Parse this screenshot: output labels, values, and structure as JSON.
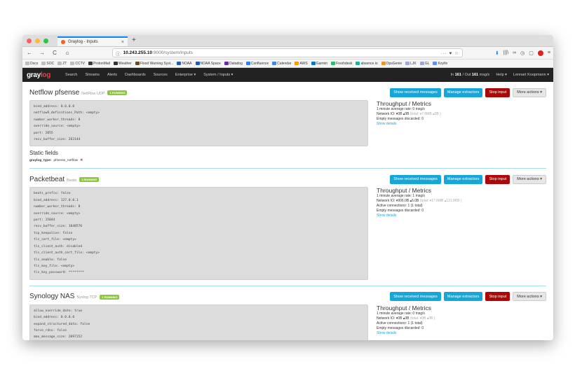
{
  "browser": {
    "tab_title": "Graylog - Inputs",
    "tab_close": "×",
    "new_tab": "+",
    "url_host": "10.243.255.10",
    "url_path": ":9000/system/inputs",
    "url_actions": "··· ♥ ☆",
    "back": "←",
    "forward": "→",
    "reload": "C",
    "home": "⌂",
    "right_icons": [
      "⬇",
      "|||\\",
      "∞",
      "◷",
      "▢",
      "≡"
    ]
  },
  "bookmarks": [
    {
      "label": "Docs",
      "color": "#bdbdbd"
    },
    {
      "label": "SOC",
      "color": "#bdbdbd"
    },
    {
      "label": "ZT",
      "color": "#bdbdbd"
    },
    {
      "label": "CCTV",
      "color": "#bdbdbd"
    },
    {
      "label": "ProtonMail",
      "color": "#3b3b3b"
    },
    {
      "label": "Weather",
      "color": "#333333"
    },
    {
      "label": "Flood Warning Syst...",
      "color": "#6a4d1f"
    },
    {
      "label": "NOAA",
      "color": "#1e5fb4"
    },
    {
      "label": "NOAA Space",
      "color": "#1e5fb4"
    },
    {
      "label": "Datadog",
      "color": "#632ca6"
    },
    {
      "label": "Confluence",
      "color": "#2684ff"
    },
    {
      "label": "Calendar",
      "color": "#4285f4"
    },
    {
      "label": "AWS",
      "color": "#ff9900"
    },
    {
      "label": "Garmin",
      "color": "#007cc3"
    },
    {
      "label": "Freshdesk",
      "color": "#25c16f"
    },
    {
      "label": "absence.io",
      "color": "#1db1a4"
    },
    {
      "label": "OpsGenie",
      "color": "#f29221"
    },
    {
      "label": "LJK",
      "color": "#9fa8da"
    },
    {
      "label": "GL",
      "color": "#9fa8da"
    },
    {
      "label": "Koyfin",
      "color": "#5b8ff9"
    }
  ],
  "graylog_nav": {
    "logo_a": "gray",
    "logo_b": "log",
    "items": [
      "Search",
      "Streams",
      "Alerts",
      "Dashboards",
      "Sources",
      "Enterprise ▾",
      "System / Inputs ▾"
    ],
    "throughput_prefix": "In ",
    "throughput_in": "161",
    "throughput_mid": " / Out ",
    "throughput_out": "161",
    "throughput_suffix": " msg/s",
    "help": "Help ▾",
    "user": "Lennart Koopmann ▾"
  },
  "buttons": {
    "show_received": "Show received messages",
    "manage_extractors": "Manage extractors",
    "stop_input": "Stop input",
    "more_actions": "More actions ▾"
  },
  "inputs": [
    {
      "title": "Netflow pfsense",
      "type": "NetFlow UDP",
      "status": "1 RUNNING",
      "config": [
        "bind_address: 0.0.0.0",
        "netflow9_definitions_Path: <empty>",
        "number_worker_threads: 8",
        "override_source: <empty>",
        "port: 2055",
        "recv_buffer_size: 262144"
      ],
      "metrics": {
        "title": "Throughput / Metrics",
        "lines": [
          "1 minute average rate: 0 msg/s"
        ],
        "network": "Network IO: ",
        "network_val": "▾0B ▴0B",
        "network_total": " (total: ▾7.6MB ▴0B )",
        "extra": [
          "Empty messages discarded: 0"
        ],
        "link": "Show details"
      },
      "static_title": "Static fields",
      "static_key": "graylog_type:",
      "static_value": "pfsense_netflow",
      "static_remove": "✖"
    },
    {
      "title": "Packetbeat",
      "type": "Beats",
      "status": "1 RUNNING",
      "config": [
        "beats_prefix: false",
        "bind_address: 127.0.0.1",
        "number_worker_threads: 8",
        "override_source: <empty>",
        "port: 15044",
        "recv_buffer_size: 1048576",
        "tcp_keepalive: false",
        "tls_cert_file: <empty>",
        "tls_client_auth: disabled",
        "tls_client_auth_cert_file: <empty>",
        "tls_enable: false",
        "tls_key_file: <empty>",
        "tls_key_password: ********"
      ],
      "metrics": {
        "title": "Throughput / Metrics",
        "lines": [
          "1 minute average rate: 1 msg/s"
        ],
        "network": "Network IO: ",
        "network_val": "▾906.0B ▴6.0B",
        "network_total": " (total: ▾17.6MB ▴131.8KB )",
        "extra": [
          "Active connections: 1 (1 total)",
          "Empty messages discarded: 0"
        ],
        "link": "Show details"
      }
    },
    {
      "title": "Synology NAS",
      "type": "Syslog TCP",
      "status": "1 RUNNING",
      "config": [
        "allow_override_date: true",
        "bind_address: 0.0.0.0",
        "expand_structured_data: false",
        "force_rdns: false",
        "max_message_size: 2097152",
        "number_worker_threads: 8"
      ],
      "metrics": {
        "title": "Throughput / Metrics",
        "lines": [
          "1 minute average rate: 0 msg/s"
        ],
        "network": "Network IO: ",
        "network_val": "▾0B ▴0B",
        "network_total": " (total: ▾0B ▴0B )",
        "extra": [
          "Active connections: 1 (1 total)",
          "Empty messages discarded: 0"
        ],
        "link": "Show details"
      }
    }
  ],
  "colors": {
    "info": "#16a7d9",
    "danger": "#ad0707",
    "running": "#8dc63f",
    "nav_bg": "#222222",
    "logo_accent": "#ff3633"
  }
}
